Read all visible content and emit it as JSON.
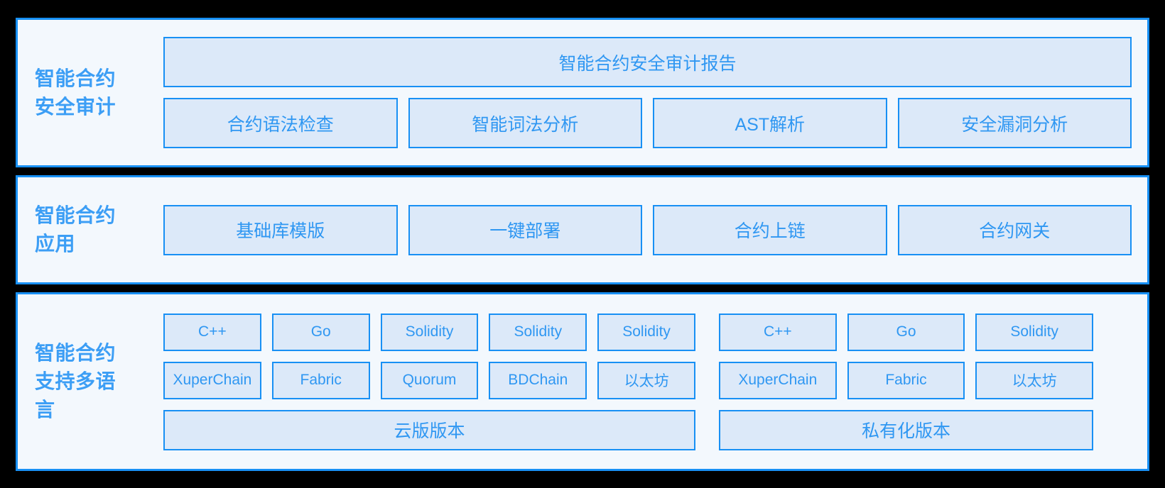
{
  "theme": {
    "page_background": "#000000",
    "section_background": "#f3f8fd",
    "section_border": "#1890f4",
    "card_background": "#dce9f9",
    "card_border": "#1890f4",
    "card_text": "#2f97f2",
    "label_text": "#3c9ef5"
  },
  "sections": [
    {
      "label": "智能合约\n安全审计",
      "banner": "智能合约安全审计报告",
      "items": [
        "合约语法检查",
        "智能词法分析",
        "AST解析",
        "安全漏洞分析"
      ]
    },
    {
      "label": "智能合约\n应用",
      "items": [
        "基础库模版",
        "一键部署",
        "合约上链",
        "合约网关"
      ]
    },
    {
      "label": "智能合约\n支持多语\n言",
      "language_row_left": [
        "C++",
        "Go",
        "Solidity",
        "Solidity",
        "Solidity"
      ],
      "language_row_right": [
        "C++",
        "Go",
        "Solidity"
      ],
      "platform_row_left": [
        "XuperChain",
        "Fabric",
        "Quorum",
        "BDChain",
        "以太坊"
      ],
      "platform_row_right": [
        "XuperChain",
        "Fabric",
        "以太坊"
      ],
      "edition_left": "云版版本",
      "edition_right": "私有化版本"
    }
  ]
}
